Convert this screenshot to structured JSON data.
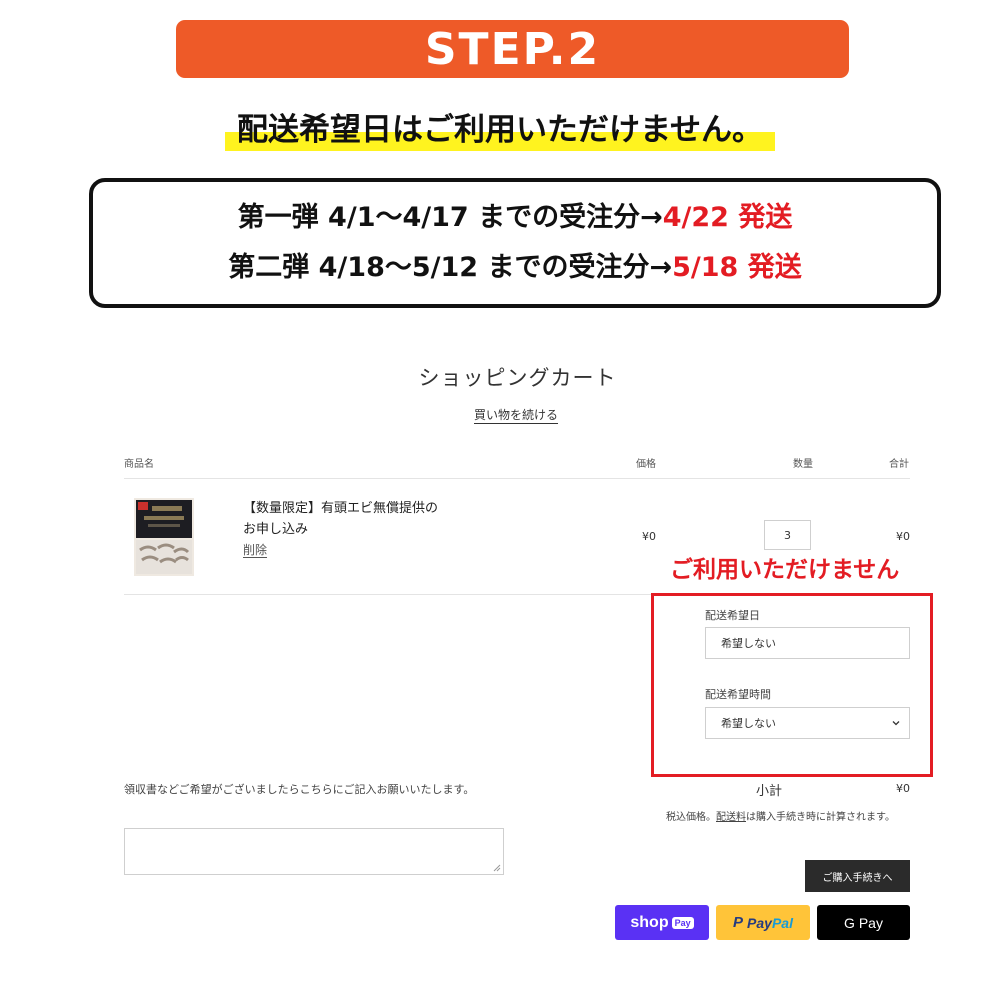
{
  "banner": {
    "step": "STEP.2"
  },
  "notice": {
    "headline": "配送希望日はご利用いただけません。"
  },
  "schedule": {
    "line1": {
      "text": "第一弾 4/1〜4/17 までの受注分→",
      "ship": "4/22 発送"
    },
    "line2": {
      "text": "第二弾 4/18〜5/12 までの受注分→",
      "ship": "5/18 発送"
    }
  },
  "cart": {
    "title": "ショッピングカート",
    "continue_link": "買い物を続ける",
    "columns": {
      "product": "商品名",
      "price": "価格",
      "quantity": "数量",
      "total": "合計"
    },
    "item": {
      "name_line1": "【数量限定】有頭エビ無償提供の",
      "name_line2": "お申し込み",
      "remove": "削除",
      "price": "¥0",
      "quantity": "3",
      "total": "¥0"
    },
    "unavailable_notice": "ご利用いただけません",
    "delivery_date": {
      "label": "配送希望日",
      "value": "希望しない"
    },
    "delivery_time": {
      "label": "配送希望時間",
      "value": "希望しない"
    },
    "note": {
      "label": "領収書などご希望がございましたらこちらにご記入お願いいたします。"
    },
    "subtotal": {
      "label": "小計",
      "value": "¥0"
    },
    "tax_note": {
      "prefix": "税込価格。",
      "link": "配送料",
      "suffix": "は購入手続き時に計算されます。"
    },
    "checkout_button": "ご購入手続きへ",
    "payments": {
      "shop": "shop",
      "shop_badge": "Pay",
      "paypal_1": "Pay",
      "paypal_2": "Pal",
      "gpay": "G Pay"
    }
  },
  "colors": {
    "banner": "#ee5a28",
    "highlight": "#fff31f",
    "alert_red": "#e31c23",
    "shop_pay": "#5a31f4",
    "paypal": "#ffc439"
  }
}
